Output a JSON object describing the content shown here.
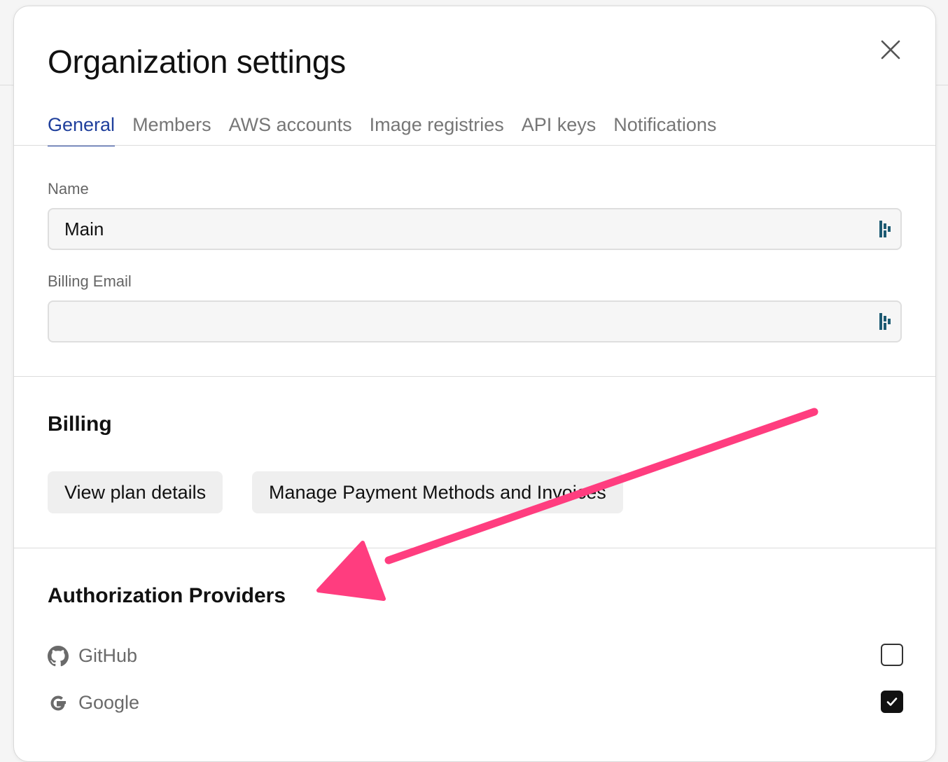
{
  "modal": {
    "title": "Organization settings"
  },
  "tabs": [
    {
      "label": "General",
      "active": true
    },
    {
      "label": "Members",
      "active": false
    },
    {
      "label": "AWS accounts",
      "active": false
    },
    {
      "label": "Image registries",
      "active": false
    },
    {
      "label": "API keys",
      "active": false
    },
    {
      "label": "Notifications",
      "active": false
    }
  ],
  "general": {
    "name_label": "Name",
    "name_value": "Main",
    "billing_email_label": "Billing Email",
    "billing_email_value": ""
  },
  "billing": {
    "heading": "Billing",
    "view_plan_label": "View plan details",
    "manage_payment_label": "Manage Payment Methods and Invoices"
  },
  "auth_providers": {
    "heading": "Authorization Providers",
    "items": [
      {
        "label": "GitHub",
        "icon": "github-icon",
        "checked": false
      },
      {
        "label": "Google",
        "icon": "google-icon",
        "checked": true
      }
    ]
  },
  "colors": {
    "active_tab": "#1f3f9c",
    "annotation_arrow": "#ff3d7f",
    "password_manager_icon": "#1c5a72"
  }
}
